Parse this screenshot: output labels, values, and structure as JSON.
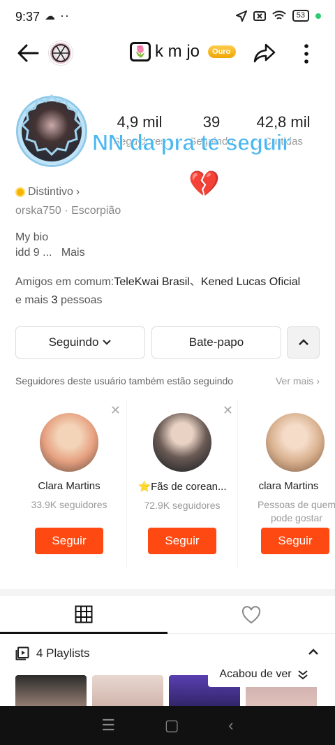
{
  "status_bar": {
    "time": "9:37",
    "battery": "53"
  },
  "header": {
    "username": "k m jo",
    "flower_emoji": "🌷",
    "badge": "Ouro"
  },
  "profile": {
    "stats": [
      {
        "value": "4,9 mil",
        "label": "Seguidores"
      },
      {
        "value": "39",
        "label": "Seguindo"
      },
      {
        "value": "42,8 mil",
        "label": "Curtidas"
      }
    ],
    "overlay_text": "NN da pra te seguir",
    "heart_emoji": "💔",
    "distintivo": "Distintivo",
    "handle": "orska750",
    "zodiac": "Escorpião",
    "bio_line1": "My bio",
    "bio_line2": "idd 9 ...",
    "bio_more": "Mais",
    "friends_prefix": "Amigos em comum:",
    "friend1": "TeleKwai Brasil",
    "friend2": "Kened Lucas Oficial",
    "friends_suffix_a": "e mais",
    "friends_count": "3",
    "friends_suffix_b": "pessoas"
  },
  "actions": {
    "following": "Seguindo",
    "chat": "Bate-papo"
  },
  "suggestions": {
    "title": "Seguidores deste usuário também estão seguindo",
    "see_more": "Ver mais",
    "cards": [
      {
        "name": "Clara Martins",
        "sub": "33.9K seguidores",
        "button": "Seguir",
        "color": "#e6a080"
      },
      {
        "name": "⭐Fãs de corean...",
        "sub": "72.9K seguidores",
        "button": "Seguir",
        "color": "#6b5b55"
      },
      {
        "name": "clara Martins",
        "sub": "Pessoas de quem pode gostar",
        "button": "Seguir",
        "color": "#d8b08e"
      }
    ]
  },
  "playlists": {
    "label": "4 Playlists",
    "watched": "Acabou de ver"
  }
}
